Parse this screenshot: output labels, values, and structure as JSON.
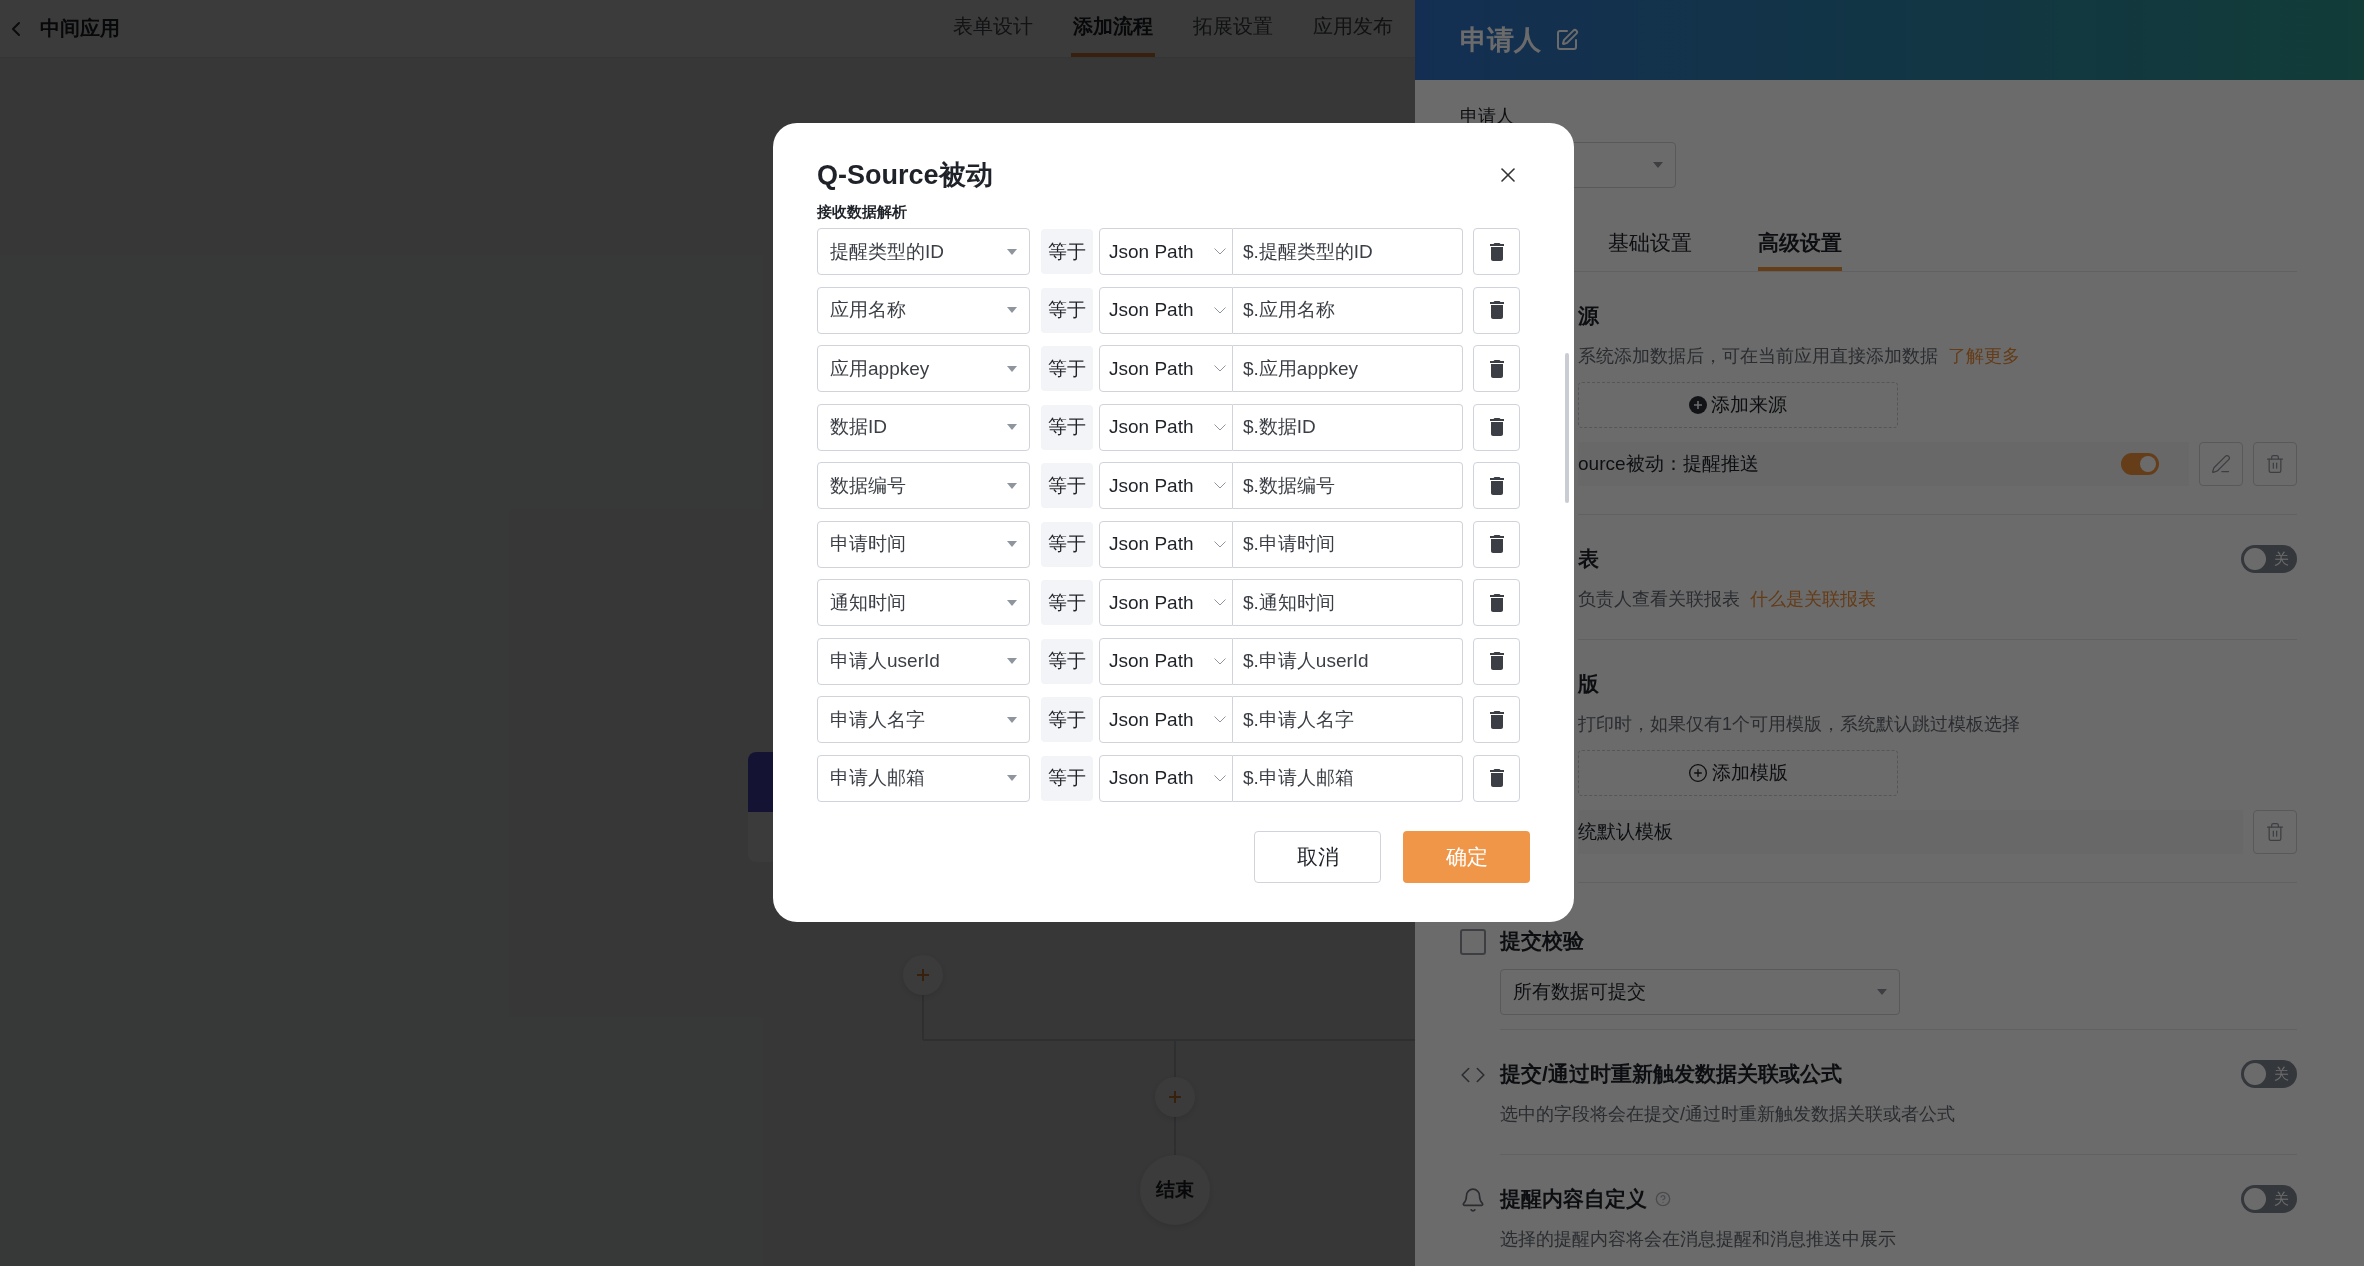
{
  "app_bar": {
    "title": "中间应用",
    "tabs": [
      {
        "label": "表单设计",
        "selected": false
      },
      {
        "label": "添加流程",
        "selected": true
      },
      {
        "label": "拓展设置",
        "selected": false
      },
      {
        "label": "应用发布",
        "selected": false
      }
    ]
  },
  "flow_canvas": {
    "end_node": "结束"
  },
  "drawer": {
    "title": "申请人",
    "field_label": "申请人",
    "tabs": [
      {
        "label": "基础设置",
        "selected": false
      },
      {
        "label": "高级设置",
        "selected": true
      }
    ],
    "sections": [
      {
        "kind": "source",
        "title": "源",
        "description": "系统添加数据后，可在当前应用直接添加数据",
        "link": "了解更多",
        "add_button": "添加来源",
        "item": {
          "label": "ource被动：提醒推送",
          "on": true
        }
      },
      {
        "kind": "report",
        "title": "表",
        "description": "负责人查看关联报表",
        "link": "什么是关联报表",
        "on": false,
        "toggle_label": "关"
      },
      {
        "kind": "template",
        "title": "版",
        "description": "打印时，如果仅有1个可用模版，系统默认跳过模板选择",
        "add_button": "添加模版",
        "item": {
          "label": "统默认模板"
        }
      },
      {
        "kind": "select",
        "title": "提交校验",
        "checked": false,
        "value": "所有数据可提交"
      },
      {
        "kind": "trigger",
        "title": "提交/通过时重新触发数据关联或公式",
        "description": "选中的字段将会在提交/通过时重新触发数据关联或者公式",
        "on": false,
        "toggle_label": "关"
      },
      {
        "kind": "reminder",
        "title": "提醒内容自定义",
        "help": true,
        "description": "选择的提醒内容将会在消息提醒和消息推送中展示",
        "on": false,
        "toggle_label": "关"
      }
    ]
  },
  "dialog": {
    "title": "Q-Source被动",
    "section_label": "接收数据解析",
    "rows": [
      {
        "field": "提醒类型的ID",
        "operator": "等于",
        "source": "Json Path",
        "path": "$.提醒类型的ID"
      },
      {
        "field": "应用名称",
        "operator": "等于",
        "source": "Json Path",
        "path": "$.应用名称"
      },
      {
        "field": "应用appkey",
        "operator": "等于",
        "source": "Json Path",
        "path": "$.应用appkey"
      },
      {
        "field": "数据ID",
        "operator": "等于",
        "source": "Json Path",
        "path": "$.数据ID"
      },
      {
        "field": "数据编号",
        "operator": "等于",
        "source": "Json Path",
        "path": "$.数据编号"
      },
      {
        "field": "申请时间",
        "operator": "等于",
        "source": "Json Path",
        "path": "$.申请时间"
      },
      {
        "field": "通知时间",
        "operator": "等于",
        "source": "Json Path",
        "path": "$.通知时间"
      },
      {
        "field": "申请人userId",
        "operator": "等于",
        "source": "Json Path",
        "path": "$.申请人userId"
      },
      {
        "field": "申请人名字",
        "operator": "等于",
        "source": "Json Path",
        "path": "$.申请人名字"
      },
      {
        "field": "申请人邮箱",
        "operator": "等于",
        "source": "Json Path",
        "path": "$.申请人邮箱"
      }
    ],
    "cancel": "取消",
    "confirm": "确定"
  }
}
